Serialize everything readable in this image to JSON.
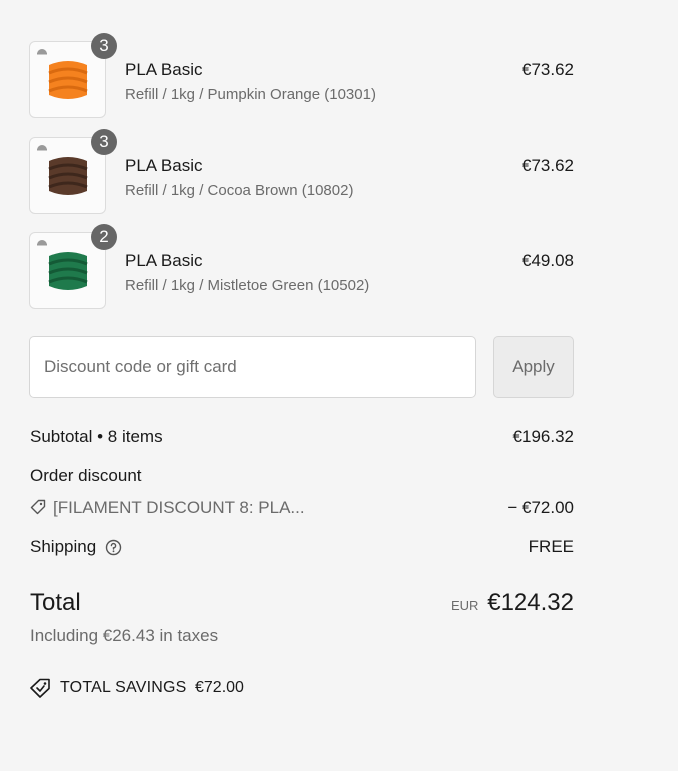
{
  "items": [
    {
      "title": "PLA Basic",
      "variant": "Refill / 1kg / Pumpkin Orange (10301)",
      "price": "€73.62",
      "qty": "3",
      "color": "#f5821f",
      "icon": "filament-spool-icon"
    },
    {
      "title": "PLA Basic",
      "variant": "Refill / 1kg / Cocoa Brown (10802)",
      "price": "€73.62",
      "qty": "3",
      "color": "#5a3a2a",
      "icon": "filament-spool-icon"
    },
    {
      "title": "PLA Basic",
      "variant": "Refill / 1kg / Mistletoe Green (10502)",
      "price": "€49.08",
      "qty": "2",
      "color": "#1f7a4c",
      "icon": "filament-spool-icon"
    }
  ],
  "discount": {
    "placeholder": "Discount code or gift card",
    "apply_label": "Apply"
  },
  "summary": {
    "subtotal_label": "Subtotal • 8 items",
    "subtotal_value": "€196.32",
    "order_discount_label": "Order discount",
    "discount_code": "[FILAMENT DISCOUNT 8: PLA...",
    "discount_value": "− €72.00",
    "shipping_label": "Shipping",
    "shipping_value": "FREE",
    "total_label": "Total",
    "currency": "EUR",
    "total_value": "€124.32",
    "tax_note": "Including €26.43 in taxes",
    "savings_label": "TOTAL SAVINGS",
    "savings_value": "€72.00"
  }
}
